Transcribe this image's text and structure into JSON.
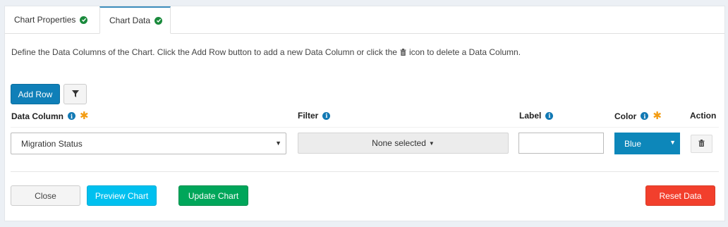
{
  "tabs": [
    {
      "label": "Chart Properties",
      "status_icon": "check-circle-icon"
    },
    {
      "label": "Chart Data",
      "status_icon": "check-circle-icon"
    }
  ],
  "description": {
    "before_icon": "Define the Data Columns of the Chart. Click the Add Row button to add a new Data Column or click the",
    "icon": "trash-icon",
    "after_icon": "icon to delete a Data Column."
  },
  "toolbar": {
    "add_row_label": "Add Row",
    "filter_icon": "filter-icon"
  },
  "columns": {
    "data_column": "Data Column",
    "filter": "Filter",
    "label": "Label",
    "color": "Color",
    "action": "Action"
  },
  "row": {
    "data_column_value": "Migration Status",
    "filter_value": "None selected",
    "label_value": "",
    "color_value": "Blue"
  },
  "footer": {
    "close_label": "Close",
    "preview_label": "Preview Chart",
    "update_label": "Update Chart",
    "reset_label": "Reset Data"
  },
  "colors": {
    "primary": "#0f7fb8",
    "info": "#00c0ef",
    "success": "#00a65a",
    "danger": "#f23f2c",
    "required_star": "#f39c12",
    "check": "#1a8a3c"
  }
}
